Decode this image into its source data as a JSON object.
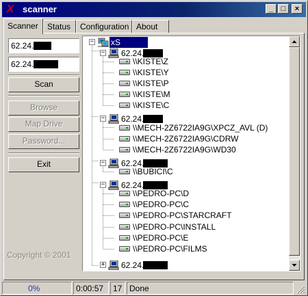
{
  "window": {
    "title": "scanner",
    "app_icon": "X"
  },
  "title_buttons": {
    "minimize": "_",
    "maximize": "□",
    "close": "×"
  },
  "tabs": [
    {
      "label": "Scanner",
      "active": true
    },
    {
      "label": "Status",
      "active": false
    },
    {
      "label": "Configuration",
      "active": false
    },
    {
      "label": "About ...",
      "active": false
    }
  ],
  "ip_fields": {
    "start": "62.24.",
    "end": "62.24."
  },
  "buttons": {
    "scan": "Scan",
    "browse": "Browse",
    "map_drive": "Map Drive",
    "password": "Password...",
    "exit": "Exit"
  },
  "copyright": "Copyright © 2001",
  "tree": {
    "root": "xS",
    "hosts": [
      {
        "ip": "62.24.",
        "shares": [
          "\\\\KISTE\\Z",
          "\\\\KISTE\\Y",
          "\\\\KISTE\\P",
          "\\\\KISTE\\M",
          "\\\\KISTE\\C"
        ]
      },
      {
        "ip": "62.24.",
        "shares": [
          "\\\\MECH-2Z6722IA9G\\XPCZ_AVL (D)",
          "\\\\MECH-2Z6722IA9G\\CDRW",
          "\\\\MECH-2Z6722IA9G\\WD30"
        ]
      },
      {
        "ip": "62.24.",
        "shares": [
          "\\\\BUBICI\\C"
        ]
      },
      {
        "ip": "62.24.",
        "shares": [
          "\\\\PEDRO-PC\\D",
          "\\\\PEDRO-PC\\C",
          "\\\\PEDRO-PC\\STARCRAFT",
          "\\\\PEDRO-PC\\INSTALL",
          "\\\\PEDRO-PC\\E",
          "\\\\PEDRO-PC\\FILMS"
        ]
      },
      {
        "ip": "62.24.",
        "shares": []
      }
    ]
  },
  "status": {
    "progress": "0%",
    "elapsed": "0:00:57",
    "count": "17",
    "message": "Done"
  },
  "colors": {
    "titlebar": "#0a246a",
    "selection": "#000080",
    "face": "#d4d0c8"
  }
}
